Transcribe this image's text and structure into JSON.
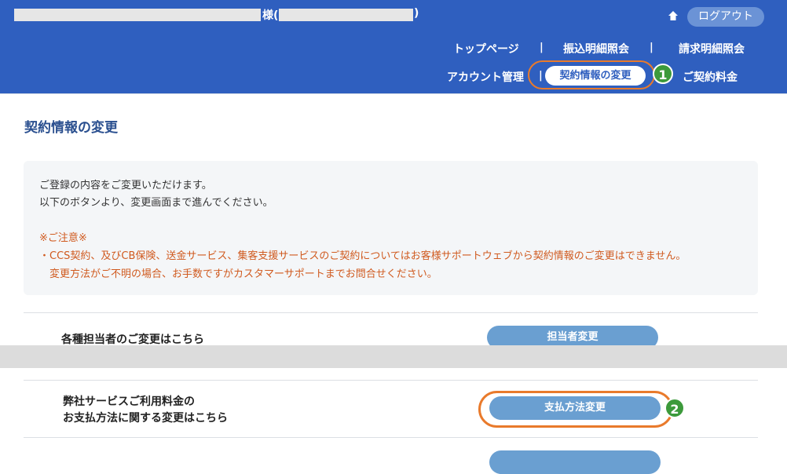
{
  "header": {
    "honorific": "様(",
    "close_paren": ")",
    "logout_label": "ログアウト",
    "nav": {
      "top": "トップページ",
      "transfer": "振込明細照会",
      "billing": "請求明細照会",
      "account": "アカウント管理",
      "contract_change": "契約情報の変更",
      "fee": "ご契約料金",
      "separator": "|"
    }
  },
  "markers": {
    "one": "1",
    "two": "2"
  },
  "page": {
    "title": "契約情報の変更",
    "notice": {
      "line1": "ご登録の内容をご変更いただけます。",
      "line2": "以下のボタンより、変更画面まで進んでください。",
      "caution_title": "※ご注意※",
      "caution_line1": "・CCS契約、及びCB保険、送金サービス、集客支援サービスのご契約についてはお客様サポートウェブから契約情報のご変更はできません。",
      "caution_line2": "変更方法がご不明の場合、お手数ですがカスタマーサポートまでお問合せください。"
    },
    "rows": [
      {
        "label": "各種担当者のご変更はこちら",
        "button": "担当者変更"
      },
      {
        "label_line1": "弊社サービスご利用料金の",
        "label_line2": "お支払方法に関する変更はこちら",
        "button": "支払方法変更"
      }
    ]
  },
  "colors": {
    "header_bg": "#2f5fbf",
    "highlight_ring": "#e97a2b",
    "badge_green": "#3c9a3b",
    "button_blue": "#6a9fd1",
    "caution_text": "#d05a1f"
  }
}
